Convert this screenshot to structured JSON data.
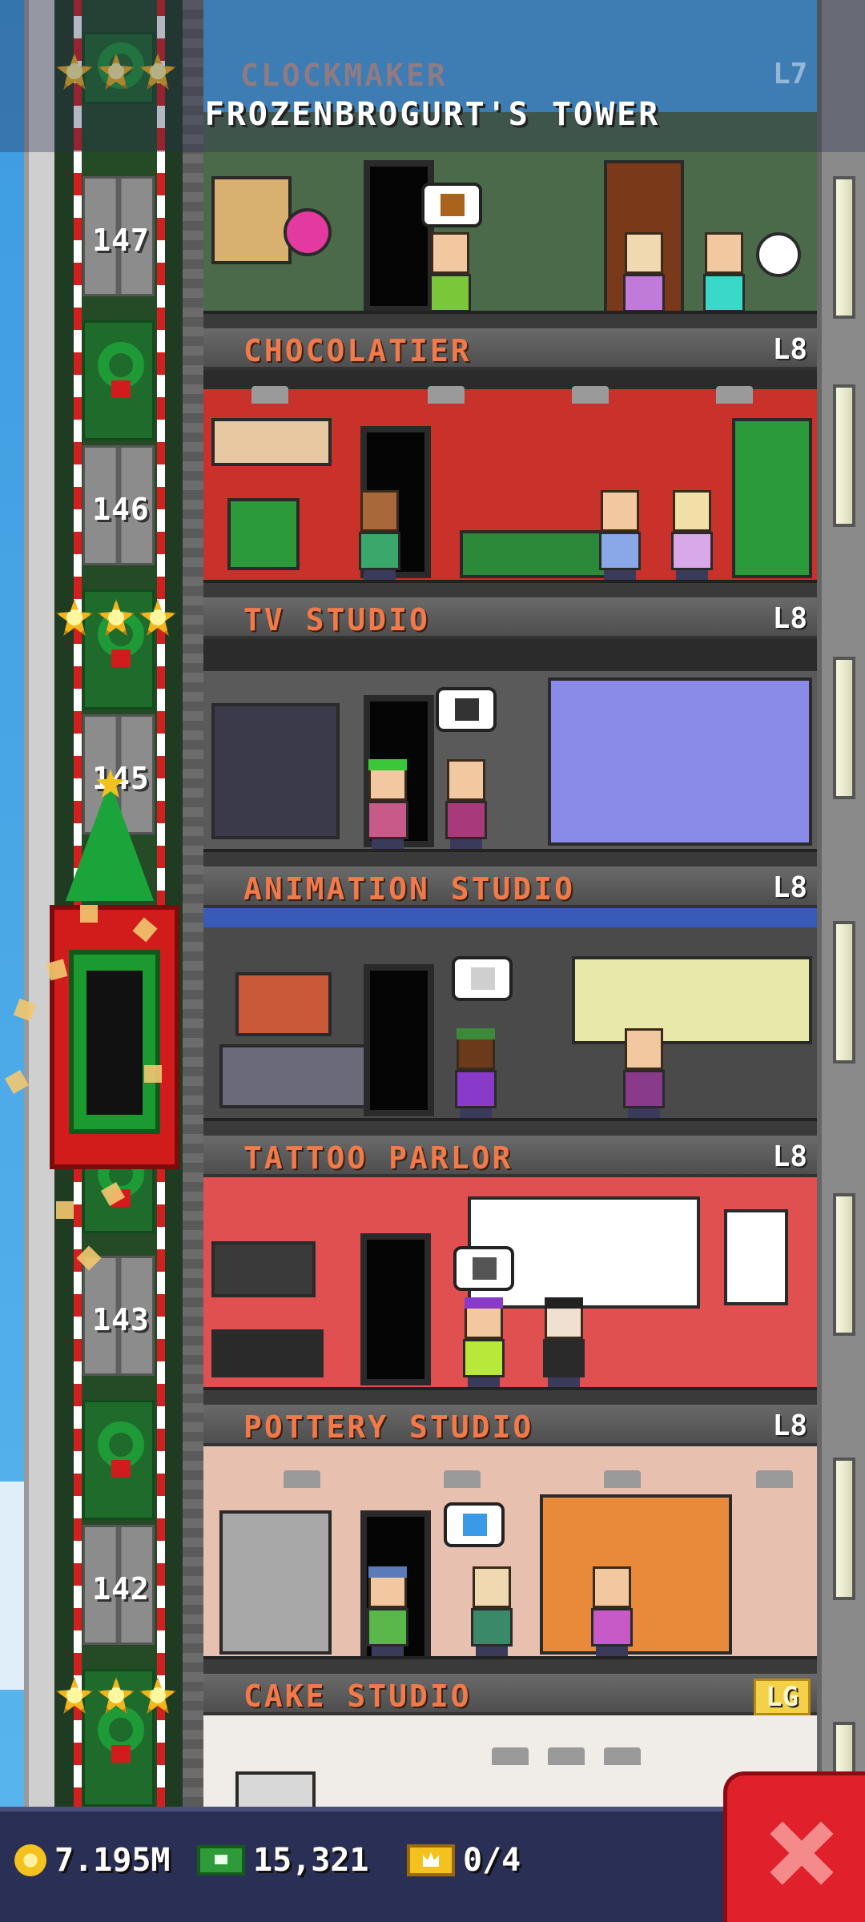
{
  "tower": {
    "title": "FROZENBROGURT'S TOWER"
  },
  "top_floor_ghost": {
    "name": "CLOCKMAKER",
    "level": "L7"
  },
  "floors": [
    {
      "name": "CHOCOLATIER",
      "level": "L8"
    },
    {
      "name": "TV STUDIO",
      "level": "L8"
    },
    {
      "name": "ANIMATION STUDIO",
      "level": "L8"
    },
    {
      "name": "TATTOO PARLOR",
      "level": "L8"
    },
    {
      "name": "POTTERY STUDIO",
      "level": "L8"
    },
    {
      "name": "CAKE STUDIO",
      "level": "LG"
    }
  ],
  "shaft_floor_numbers": [
    "147",
    "146",
    "145",
    "143",
    "142"
  ],
  "status_bar": {
    "coins": "7.195M",
    "bux": "15,321",
    "vip": "0/4"
  },
  "colors": {
    "floor_name": "#f07a4a",
    "close_button": "#e0202a",
    "bottom_bar": "#2a2f55"
  },
  "icons": [
    "coin-icon",
    "bux-icon",
    "vip-icon",
    "close-icon",
    "wreath-icon",
    "star-icon"
  ]
}
